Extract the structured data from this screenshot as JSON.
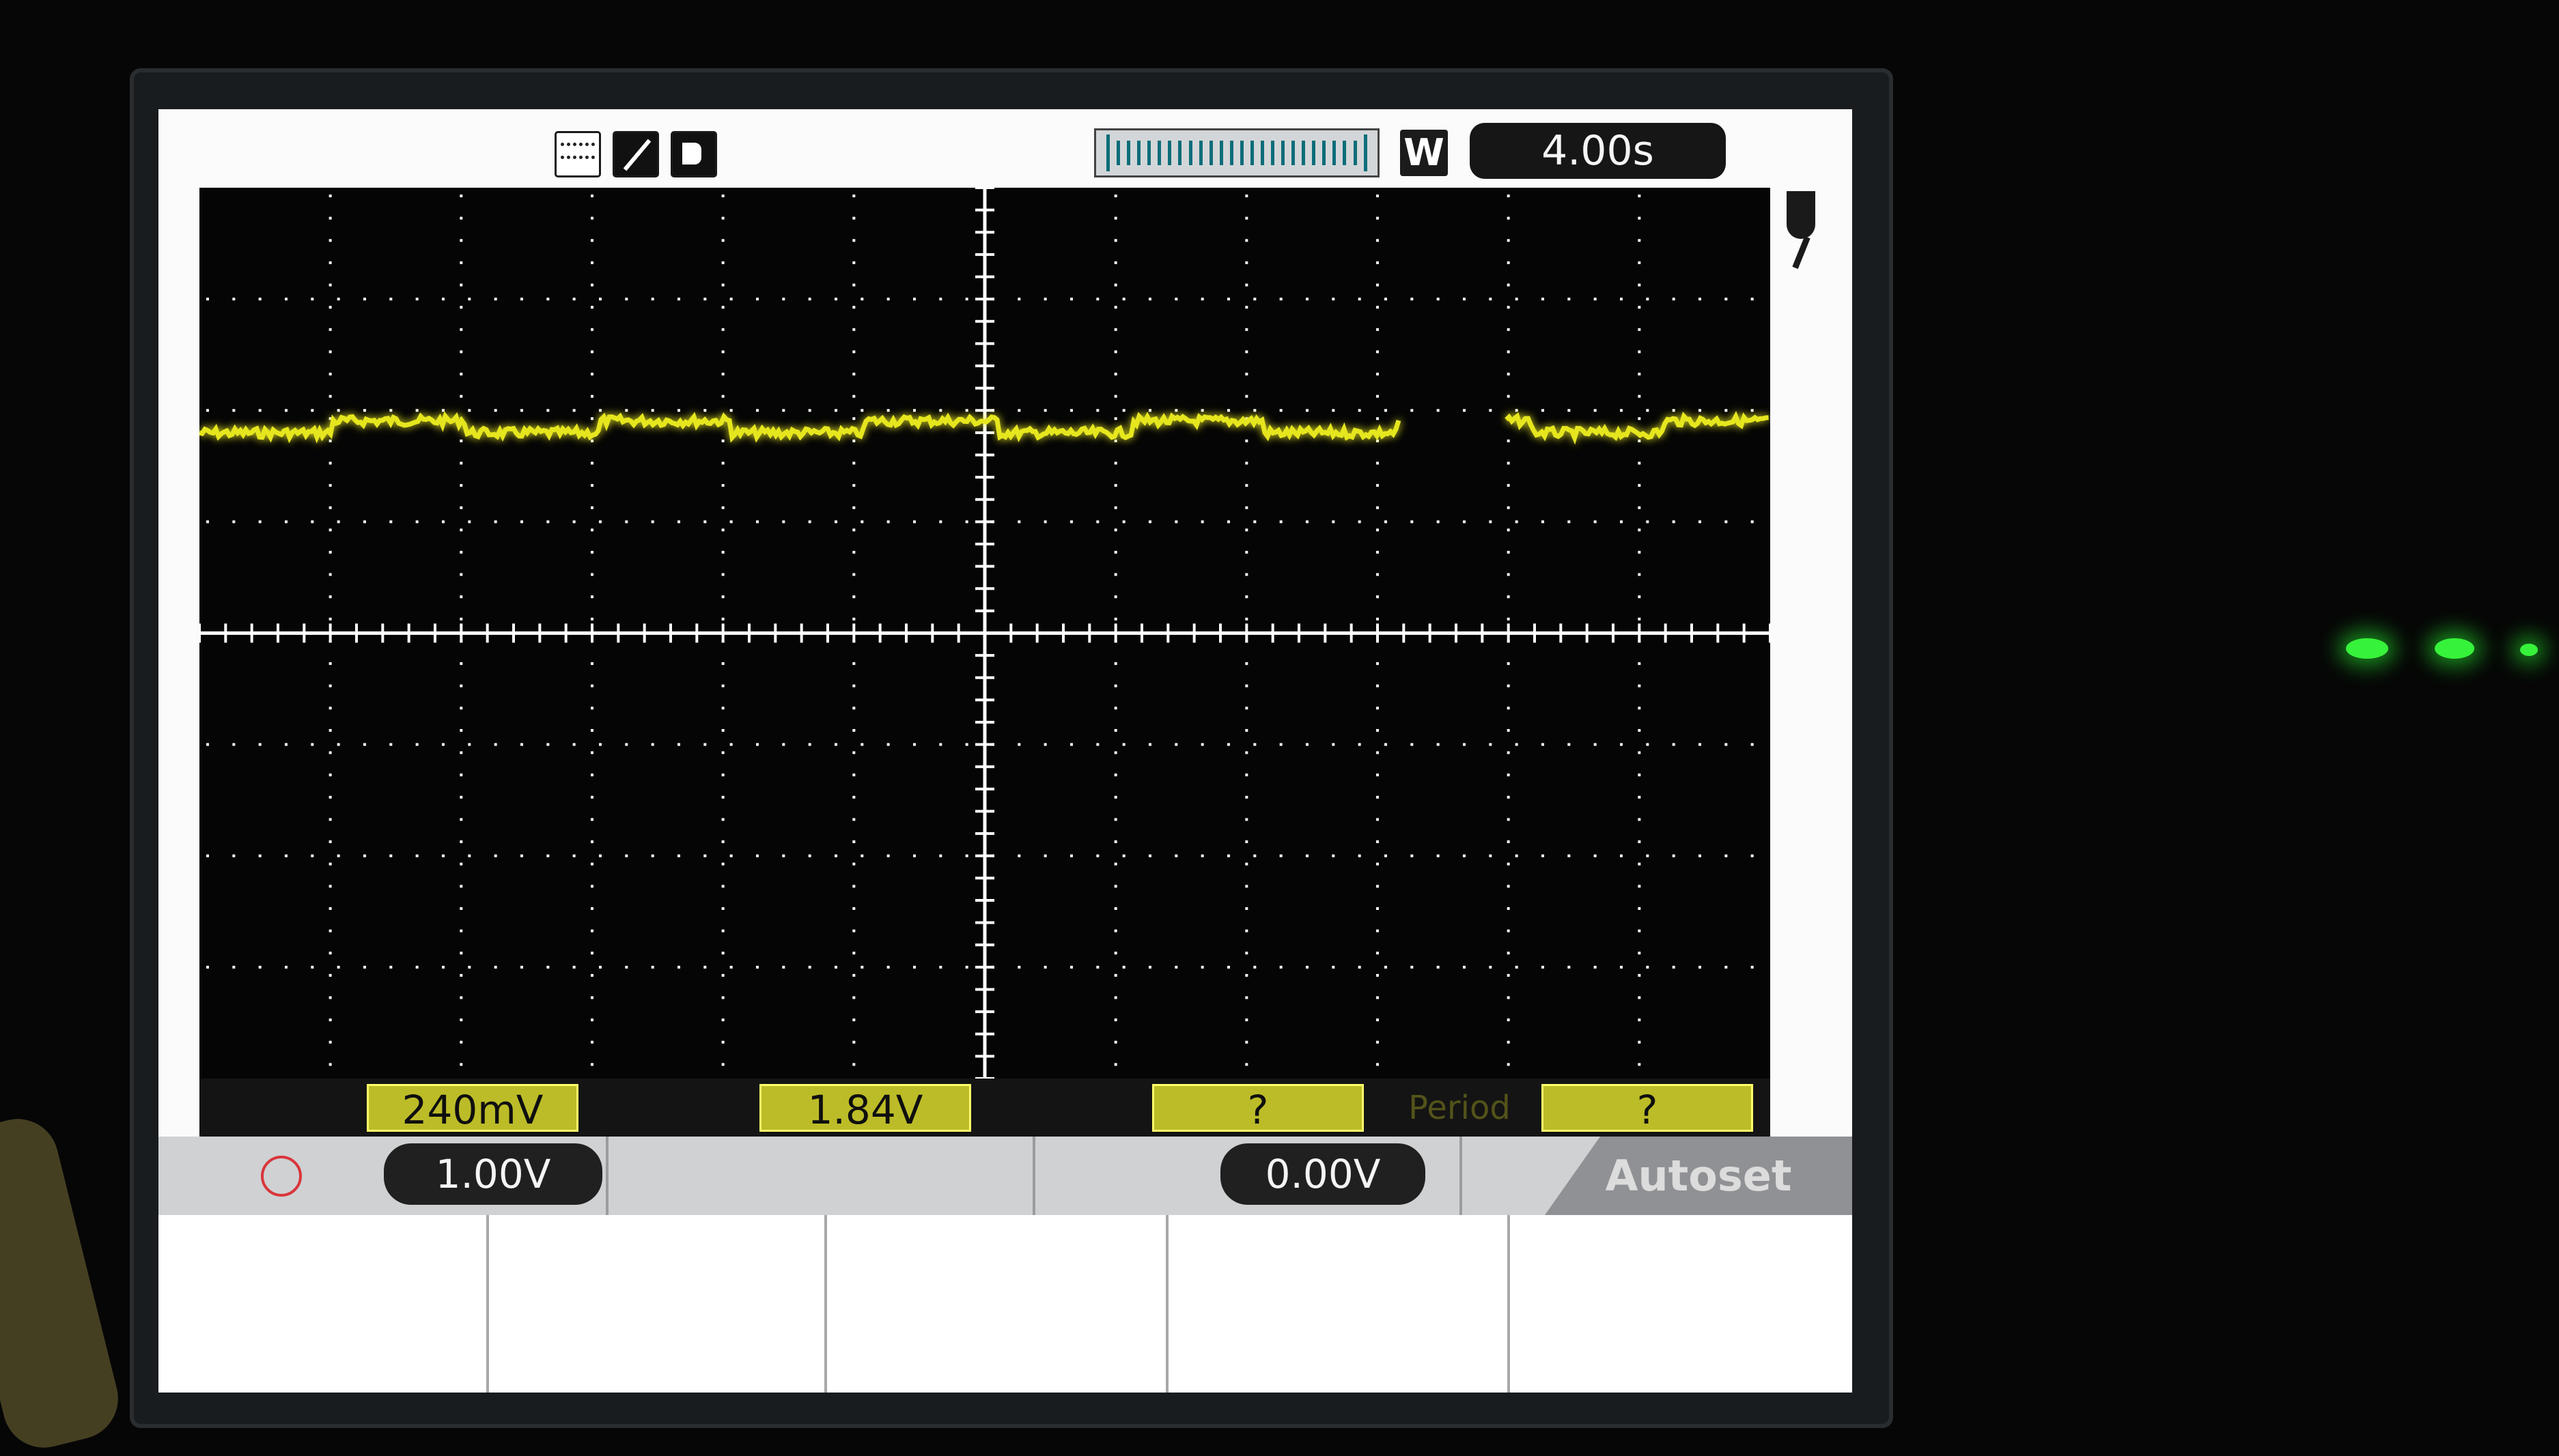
{
  "header": {
    "timebase": "4.00s",
    "window_mode": "W",
    "acq_mode_icon": "peak-detect-icon",
    "trigger_slope_icon": "rising-edge-icon",
    "trigger_status_icon": "trigger-status-icon",
    "power_icon": "power-plug-icon"
  },
  "measurements": [
    {
      "id": "pk-pk",
      "value": "240mV"
    },
    {
      "id": "mean",
      "value": "1.84V"
    },
    {
      "id": "freq",
      "value": "?"
    },
    {
      "id": "period",
      "label": "Period",
      "value": "?"
    }
  ],
  "controls": {
    "channel_scale": "1.00V",
    "trigger_level": "0.00V",
    "autoset": "Autoset"
  },
  "trace": {
    "color": "#e6e61f",
    "level_volts": 1.84,
    "volts_per_div": 1.0,
    "center_volts": 0,
    "ripple_pk_pk_volts": 0.24,
    "gap_fraction": [
      0.765,
      0.832
    ]
  },
  "colors": {
    "grid_background": "#050505",
    "graticule": "#ffffff",
    "measure_value_bg": "#bcbc28",
    "channel_badge": "#d9363a",
    "status_led": "#37f23a"
  }
}
